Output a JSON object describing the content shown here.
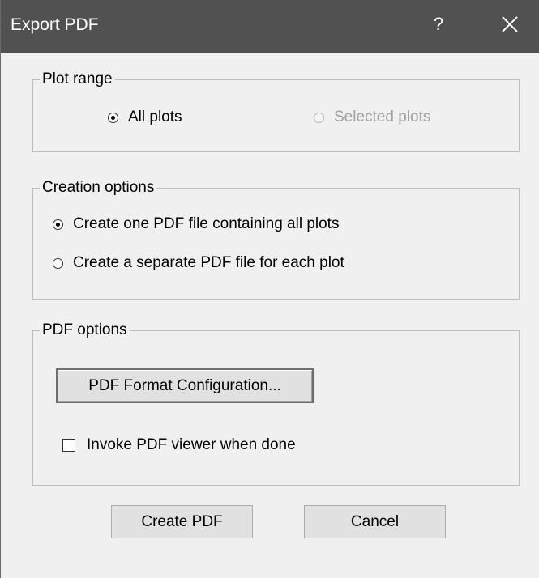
{
  "window": {
    "title": "Export PDF",
    "help_label": "?"
  },
  "plot_range": {
    "legend": "Plot range",
    "options": [
      {
        "label": "All plots",
        "checked": true,
        "enabled": true
      },
      {
        "label": "Selected plots",
        "checked": false,
        "enabled": false
      }
    ]
  },
  "creation_options": {
    "legend": "Creation options",
    "options": [
      {
        "label": "Create one PDF file containing all plots",
        "checked": true
      },
      {
        "label": "Create a separate PDF file for each plot",
        "checked": false
      }
    ]
  },
  "pdf_options": {
    "legend": "PDF options",
    "format_button": "PDF Format Configuration...",
    "viewer_checkbox": {
      "label": "Invoke PDF viewer when done",
      "checked": false
    }
  },
  "footer": {
    "create_button": "Create PDF",
    "cancel_button": "Cancel"
  },
  "colors": {
    "titlebar": "#515151",
    "dialog_bg": "#f0f0f0",
    "disabled_text": "#a0a0a0"
  },
  "icons": {
    "close": "close-icon"
  }
}
